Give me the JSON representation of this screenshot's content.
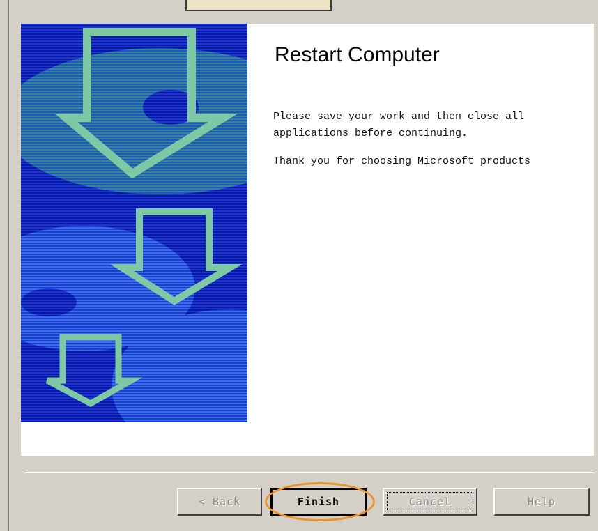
{
  "wizard": {
    "title": "Restart Computer",
    "message_line1": "Please save your work and then close all",
    "message_line2": "applications before continuing.",
    "message_line3": "Thank you for choosing Microsoft products"
  },
  "buttons": {
    "back": "< Back",
    "finish": "Finish",
    "cancel": "Cancel",
    "help": "Help"
  },
  "colors": {
    "banner": "#0c1fb8",
    "arrow": "#7ec8a6",
    "highlight": "#f0922a"
  },
  "icons": {
    "banner": "download-arrows-illustration"
  }
}
